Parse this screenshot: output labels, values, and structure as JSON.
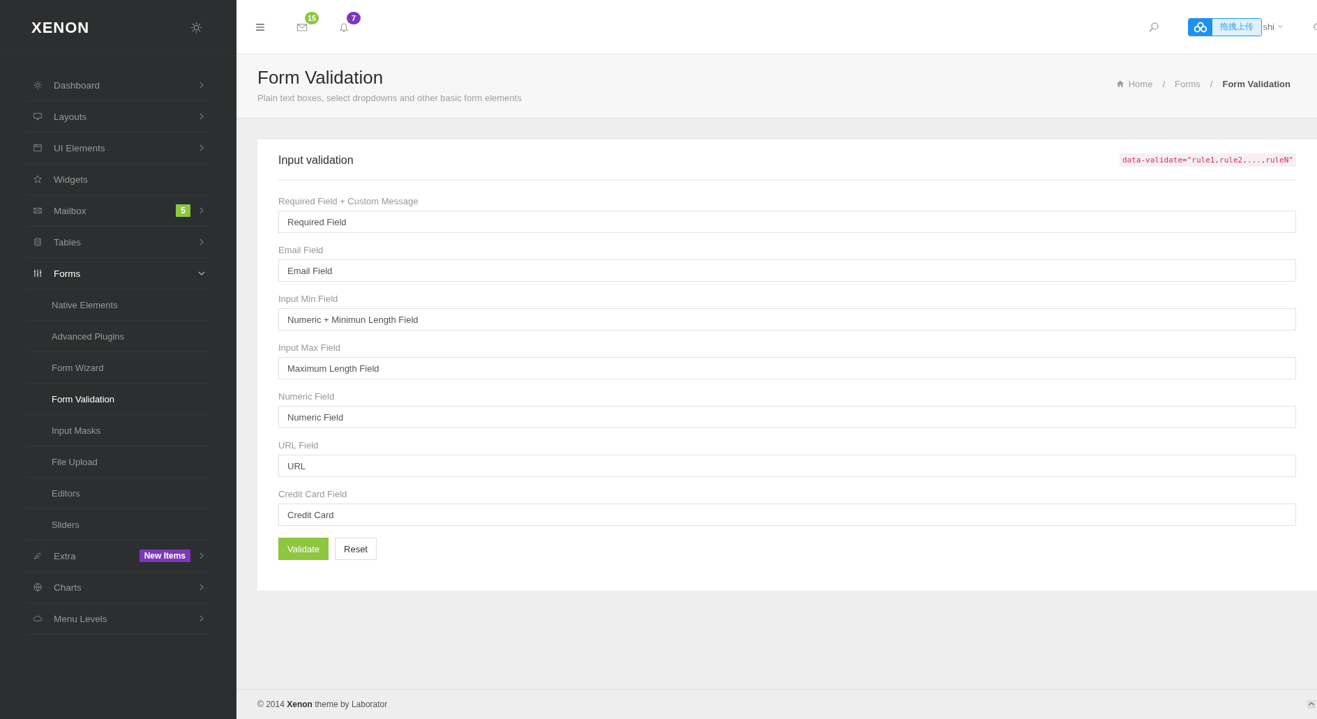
{
  "sidebar": {
    "logo": "XENON",
    "items": [
      {
        "label": "Dashboard",
        "selected": false,
        "expanded": false
      },
      {
        "label": "Layouts",
        "selected": false,
        "expanded": false
      },
      {
        "label": "UI Elements",
        "selected": false,
        "expanded": false
      },
      {
        "label": "Widgets",
        "selected": false
      },
      {
        "label": "Mailbox",
        "selected": false,
        "expanded": false,
        "badge": {
          "text": "5",
          "color": "#8dc63f"
        }
      },
      {
        "label": "Tables",
        "selected": false,
        "expanded": false
      },
      {
        "label": "Forms",
        "selected": true,
        "expanded": true,
        "children": [
          {
            "label": "Native Elements",
            "selected": false
          },
          {
            "label": "Advanced Plugins",
            "selected": false
          },
          {
            "label": "Form Wizard",
            "selected": false
          },
          {
            "label": "Form Validation",
            "selected": true
          },
          {
            "label": "Input Masks",
            "selected": false
          },
          {
            "label": "File Upload",
            "selected": false
          },
          {
            "label": "Editors",
            "selected": false
          },
          {
            "label": "Sliders",
            "selected": false
          }
        ]
      },
      {
        "label": "Extra",
        "selected": false,
        "expanded": false,
        "badge": {
          "text": "New Items",
          "color": "#7c38bc"
        }
      },
      {
        "label": "Charts",
        "selected": false,
        "expanded": false
      },
      {
        "label": "Menu Levels",
        "selected": false,
        "expanded": false
      }
    ]
  },
  "topbar": {
    "messages_count": "15",
    "notifications_count": "7",
    "upload_widget": "拖拽上传",
    "user": "shi"
  },
  "page_header": {
    "title": "Form Validation",
    "subtitle": "Plain text boxes, select dropdowns and other basic form elements",
    "breadcrumb": [
      {
        "label": "Home",
        "selected": false
      },
      {
        "separator": "/",
        "label": "Forms",
        "selected": false
      },
      {
        "separator": "/",
        "label": "Form Validation",
        "selected": true
      }
    ]
  },
  "panel": {
    "title": "Input validation",
    "code": "data-validate=\"rule1,rule2,...,ruleN\"",
    "fields": [
      {
        "label": "Required Field + Custom Message",
        "placeholder": "Required Field"
      },
      {
        "label": "Email Field",
        "placeholder": "Email Field"
      },
      {
        "label": "Input Min Field",
        "placeholder": "Numeric + Minimun Length Field"
      },
      {
        "label": "Input Max Field",
        "placeholder": "Maximum Length Field"
      },
      {
        "label": "Numeric Field",
        "placeholder": "Numeric Field"
      },
      {
        "label": "URL Field",
        "placeholder": "URL"
      },
      {
        "label": "Credit Card Field",
        "placeholder": "Credit Card"
      }
    ],
    "buttons": [
      {
        "label": "Validate",
        "kind": "primary"
      },
      {
        "label": "Reset",
        "kind": "default"
      }
    ]
  },
  "footer": "© 2014 **Xenon** theme by Laborator"
}
